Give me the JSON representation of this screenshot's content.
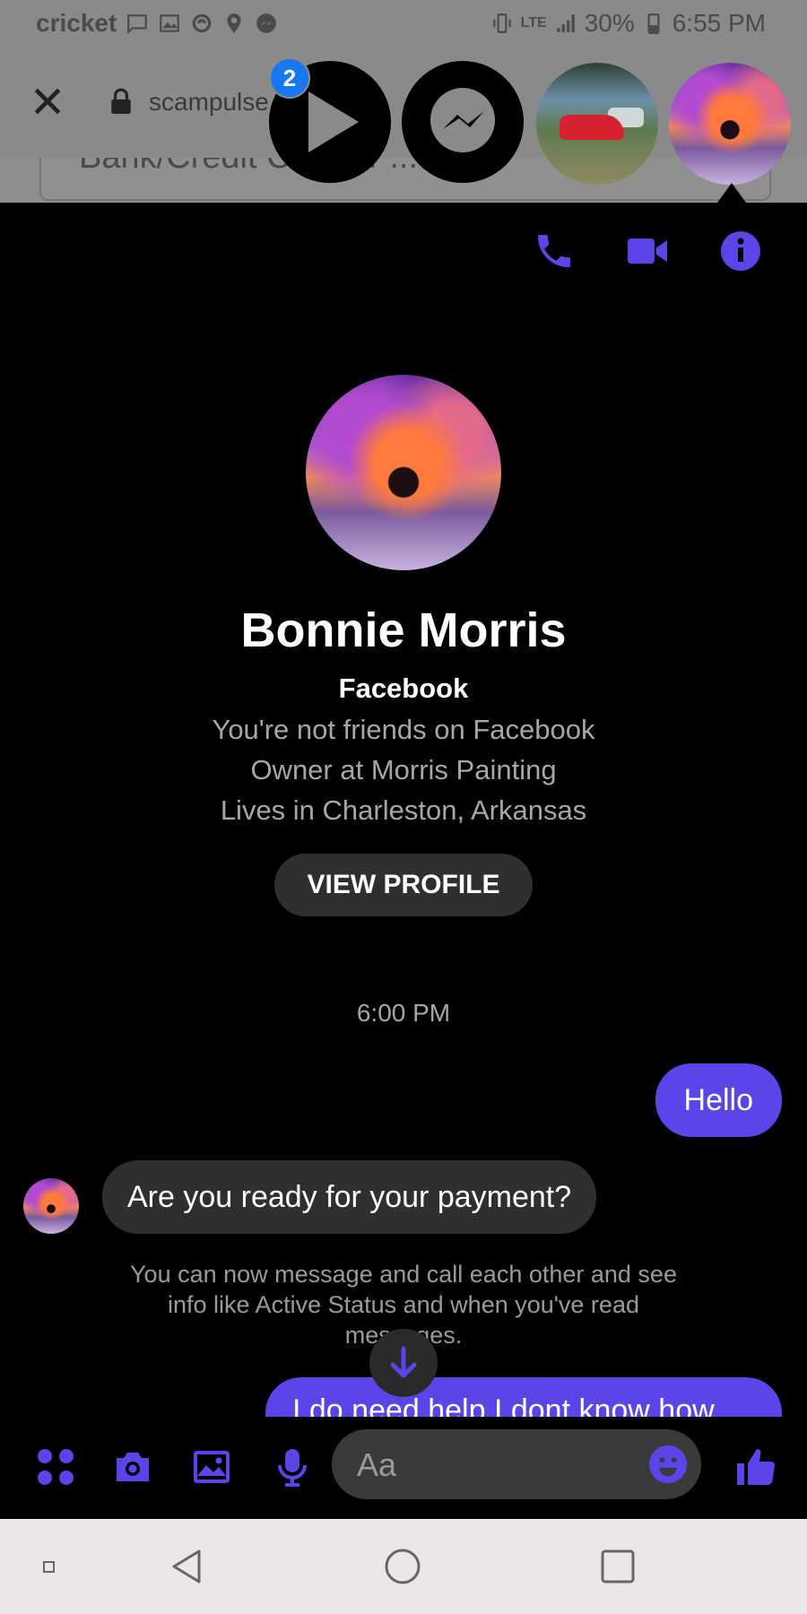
{
  "status_bar": {
    "carrier": "cricket",
    "network": "LTE",
    "battery": "30%",
    "time": "6:55 PM"
  },
  "browser": {
    "url": "scampulse",
    "underlying_field_text": "Bank/Credit Card or ..."
  },
  "chat_heads": {
    "badge_count": "2"
  },
  "conversation": {
    "contact_name": "Bonnie Morris",
    "source": "Facebook",
    "friend_status": "You're not friends on Facebook",
    "work": "Owner at Morris Painting",
    "location": "Lives in Charleston, Arkansas",
    "view_profile_label": "VIEW PROFILE",
    "timestamp": "6:00 PM",
    "messages": [
      {
        "direction": "out",
        "text": "Hello"
      },
      {
        "direction": "in",
        "text": "Are you ready for your payment?"
      },
      {
        "direction": "out",
        "text": "I do need help I dont know how"
      }
    ],
    "notice": "You can now message and call each other and see info like Active Status and when you've read messages."
  },
  "composer": {
    "placeholder": "Aa"
  },
  "colors": {
    "accent": "#5b45e8",
    "panel_bg": "#000000",
    "incoming_bubble": "#2f2f2f",
    "muted_text": "#a6a6a6"
  }
}
